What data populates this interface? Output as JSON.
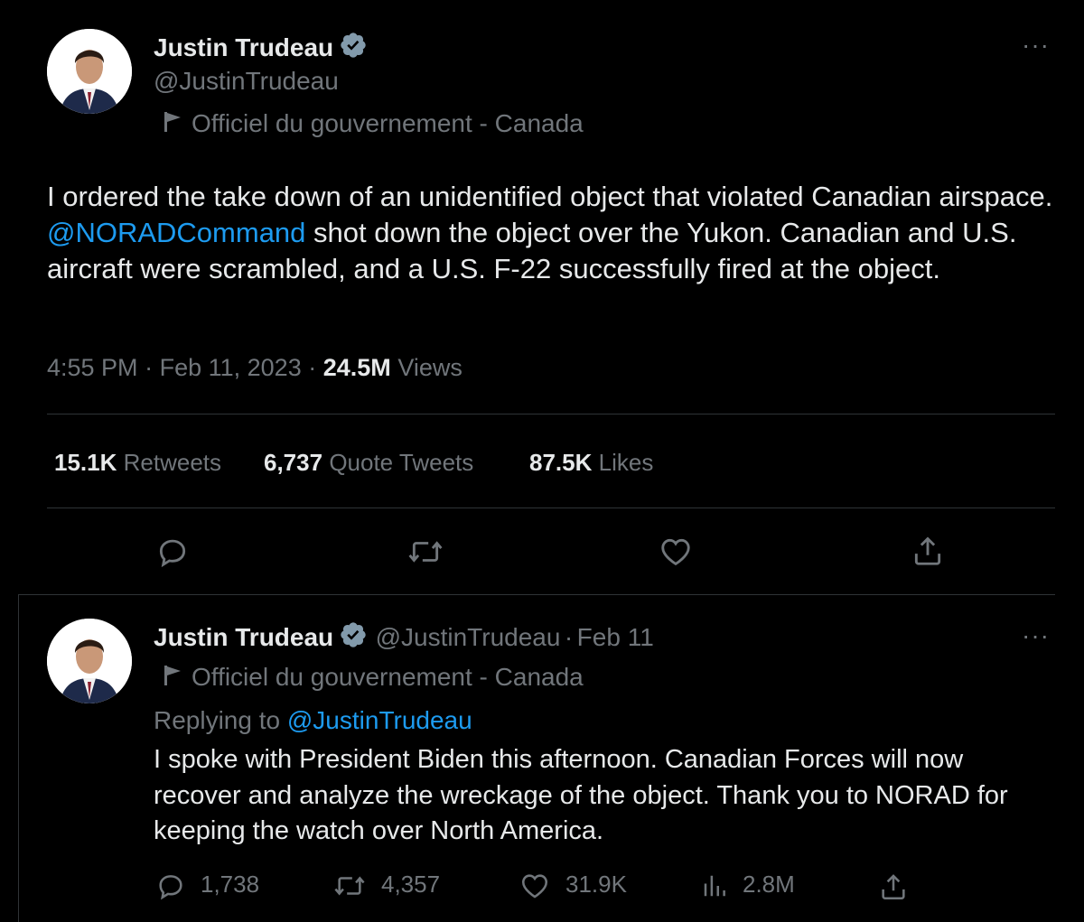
{
  "tweet": {
    "author_name": "Justin Trudeau",
    "author_handle": "@JustinTrudeau",
    "account_label": "Officiel du gouvernement - Canada",
    "text_before_mention": "I ordered the take down of an unidentified object that violated Canadian airspace. ",
    "mention": "@NORADCommand",
    "text_after_mention": " shot down the object over the Yukon. Canadian and U.S. aircraft were scrambled, and a U.S. F-22 successfully fired at the object.",
    "time": "4:55 PM",
    "date": "Feb 11, 2023",
    "views_count": "24.5M",
    "views_label": "Views",
    "separator": "·",
    "retweets_count": "15.1K",
    "retweets_label": "Retweets",
    "quotes_count": "6,737",
    "quotes_label": "Quote Tweets",
    "likes_count": "87.5K",
    "likes_label": "Likes",
    "more_label": "···"
  },
  "reply": {
    "author_name": "Justin Trudeau",
    "author_handle": "@JustinTrudeau",
    "date": "Feb 11",
    "account_label": "Officiel du gouvernement - Canada",
    "replying_to_label": "Replying to",
    "replying_to_handle": "@JustinTrudeau",
    "text": "I spoke with President Biden this afternoon. Canadian Forces will now recover and analyze the wreckage of the object. Thank you to NORAD for keeping the watch over North America.",
    "replies_count": "1,738",
    "retweets_count": "4,357",
    "likes_count": "31.9K",
    "views_count": "2.8M",
    "more_label": "···"
  },
  "colors": {
    "background": "#000000",
    "text": "#e7e9ea",
    "muted": "#71767b",
    "link": "#1d9bf0",
    "verified": "#829aab",
    "divider": "#2f3336"
  },
  "icons": [
    "verified-badge-icon",
    "flag-icon",
    "more-icon",
    "reply-icon",
    "retweet-icon",
    "like-icon",
    "share-icon",
    "views-icon"
  ]
}
